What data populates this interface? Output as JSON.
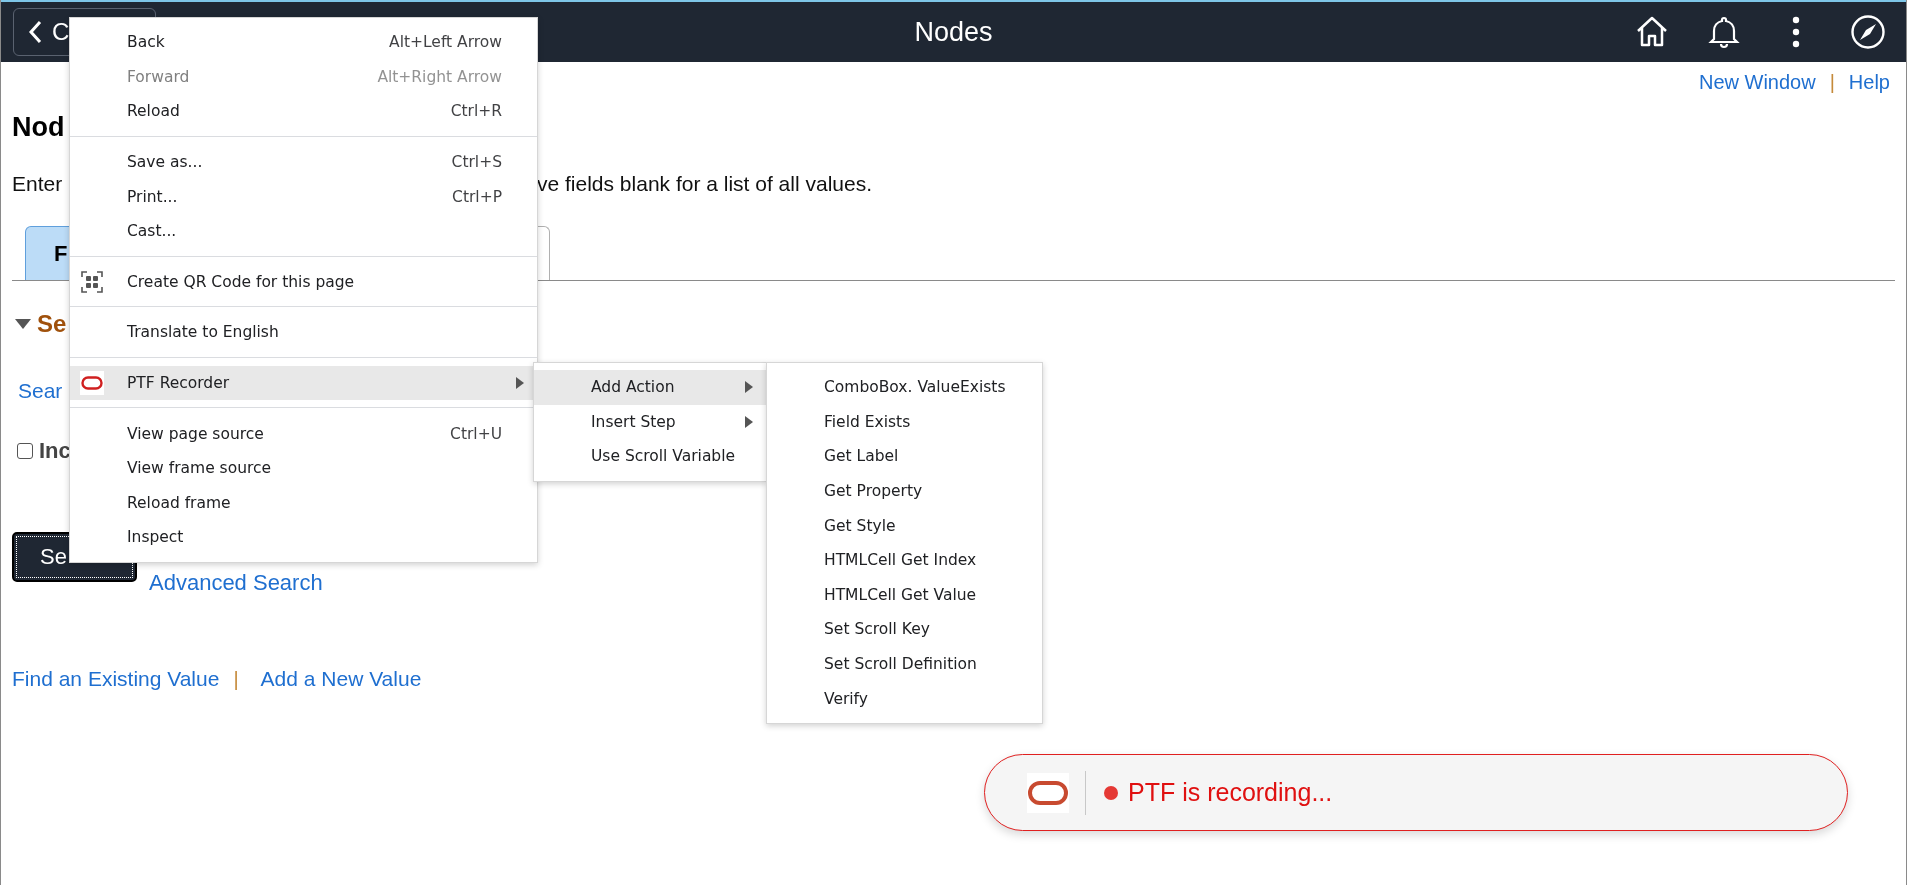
{
  "header": {
    "back_label": "C",
    "title": "Nodes"
  },
  "top_links": [
    {
      "kind": "link",
      "text": "New Window"
    },
    {
      "kind": "separator",
      "text": "|"
    },
    {
      "kind": "link",
      "text": "Help"
    }
  ],
  "page": {
    "heading": "Nod",
    "instructions": [
      "Enter",
      "ve fields blank for a list of all values."
    ],
    "tabs": [
      {
        "label": "F",
        "selected": true
      },
      {
        "selected": false
      }
    ],
    "section": {
      "title": "Se",
      "expanded": true
    },
    "search_link": "Sear",
    "checkbox": {
      "label": "Inc",
      "checked": false
    },
    "search_button": "Se",
    "advanced_search": "Advanced Search"
  },
  "footer_links": [
    {
      "kind": "link",
      "text": "Find an Existing Value"
    },
    {
      "kind": "separator",
      "text": "|"
    },
    {
      "kind": "link",
      "text": "Add a New Value"
    }
  ],
  "context_menu": {
    "sections": [
      {
        "items": [
          {
            "label": "Back",
            "shortcut": "Alt+Left Arrow",
            "disabled": false,
            "kind": "plain",
            "selected": false
          },
          {
            "label": "Forward",
            "shortcut": "Alt+Right Arrow",
            "disabled": true,
            "kind": "plain",
            "selected": false
          },
          {
            "label": "Reload",
            "shortcut": "Ctrl+R",
            "disabled": false,
            "kind": "plain",
            "selected": false
          }
        ]
      },
      {
        "items": [
          {
            "label": "Save as...",
            "shortcut": "Ctrl+S",
            "disabled": false,
            "kind": "plain",
            "selected": false
          },
          {
            "label": "Print...",
            "shortcut": "Ctrl+P",
            "disabled": false,
            "kind": "plain",
            "selected": false
          },
          {
            "label": "Cast...",
            "disabled": false,
            "kind": "plain",
            "selected": false
          }
        ]
      },
      {
        "items": [
          {
            "label": "Create QR Code for this page",
            "disabled": false,
            "kind": "qr",
            "selected": false
          }
        ]
      },
      {
        "items": [
          {
            "label": "Translate to English",
            "disabled": false,
            "kind": "plain",
            "selected": false
          }
        ]
      },
      {
        "items": [
          {
            "label": "PTF Recorder",
            "disabled": false,
            "kind": "extension",
            "selected": true
          }
        ]
      },
      {
        "items": [
          {
            "label": "View page source",
            "shortcut": "Ctrl+U",
            "disabled": false,
            "kind": "plain",
            "selected": false
          },
          {
            "label": "View frame source",
            "disabled": false,
            "kind": "plain",
            "selected": false
          },
          {
            "label": "Reload frame",
            "disabled": false,
            "kind": "plain",
            "selected": false
          },
          {
            "label": "Inspect",
            "disabled": false,
            "kind": "plain",
            "selected": false
          }
        ]
      }
    ]
  },
  "submenu": {
    "items": [
      {
        "label": "Add Action",
        "has_submenu": true,
        "selected": true
      },
      {
        "label": "Insert Step",
        "has_submenu": true,
        "selected": false
      },
      {
        "label": "Use Scroll Variable",
        "has_submenu": false,
        "selected": false
      }
    ]
  },
  "action_menu": {
    "items": [
      "ComboBox. ValueExists",
      "Field Exists",
      "Get Label",
      "Get Property",
      "Get Style",
      "HTMLCell Get Index",
      "HTMLCell Get Value",
      "Set Scroll Key",
      "Set Scroll Definition",
      "Verify"
    ]
  },
  "recorder_status": {
    "text": "PTF is recording..."
  }
}
